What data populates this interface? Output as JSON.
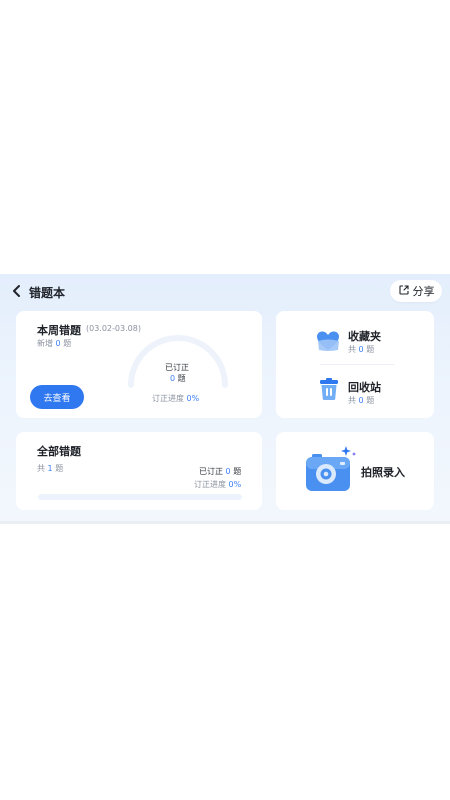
{
  "header": {
    "title": "错题本",
    "share_label": "分享"
  },
  "week_card": {
    "title": "本周错题",
    "date_range": "(03.02-03.08)",
    "new_prefix": "新增",
    "new_count": "0",
    "new_suffix": "题",
    "button_label": "去查看",
    "corrected_label": "已订正",
    "corrected_count": "0",
    "corrected_unit": "题",
    "progress_label": "订正进度",
    "progress_value": "0%",
    "progress_fraction": 0
  },
  "favorites": {
    "label": "收藏夹",
    "count_prefix": "共",
    "count": "0",
    "count_suffix": "题"
  },
  "recycle": {
    "label": "回收站",
    "count_prefix": "共",
    "count": "0",
    "count_suffix": "题"
  },
  "all_card": {
    "title": "全部错题",
    "total_prefix": "共",
    "total_count": "1",
    "total_suffix": "题",
    "corrected_label": "已订正",
    "corrected_count": "0",
    "corrected_unit": "题",
    "progress_label": "订正进度",
    "progress_value": "0%",
    "progress_fraction": 0
  },
  "photo": {
    "label": "拍照录入"
  },
  "colors": {
    "accent": "#2f78f0",
    "number": "#3d7ff5",
    "background": "#e3eefc"
  }
}
